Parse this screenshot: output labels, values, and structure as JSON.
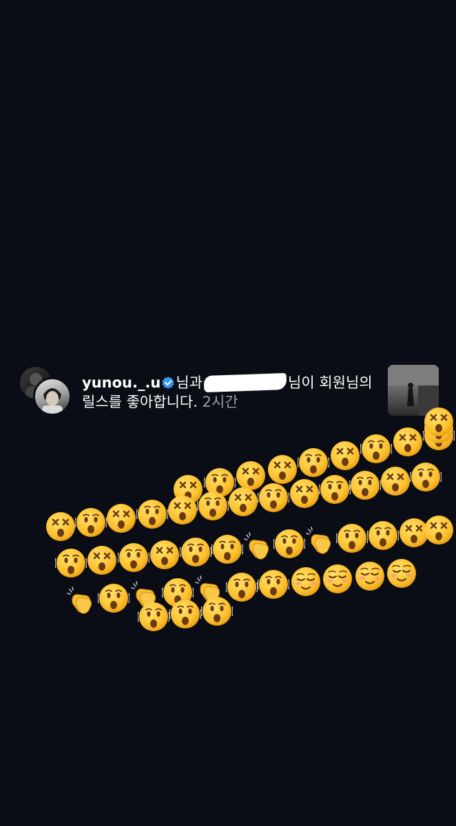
{
  "notification": {
    "username": "yunou._.u",
    "text_after_username": "님과",
    "text_after_redaction": "님이 회원님의",
    "line2_text": "릴스를 좋아합니다.",
    "time": "2시간"
  },
  "emoji_rows": [
    [
      "dizzy",
      "astonished",
      "dizzy",
      "dizzy",
      "astonished",
      "dizzy",
      "astonished",
      "dizzy",
      "astonished",
      "dizzy",
      "dizzy"
    ],
    [
      "dizzy",
      "astonished",
      "dizzy",
      "astonished",
      "dizzy",
      "astonished",
      "dizzy",
      "astonished",
      "dizzy",
      "astonished",
      "astonished",
      "dizzy",
      "astonished"
    ],
    [
      "astonished",
      "dizzy",
      "astonished",
      "dizzy",
      "astonished",
      "astonished",
      "clap",
      "astonished",
      "clap",
      "astonished",
      "astonished",
      "dizzy",
      "dizzy"
    ],
    [
      "clap",
      "astonished",
      "clap",
      "astonished",
      "clap",
      "astonished",
      "astonished",
      "relaxed",
      "relaxed",
      "relaxed",
      "relaxed"
    ],
    [
      "astonished",
      "astonished",
      "astonished"
    ]
  ]
}
